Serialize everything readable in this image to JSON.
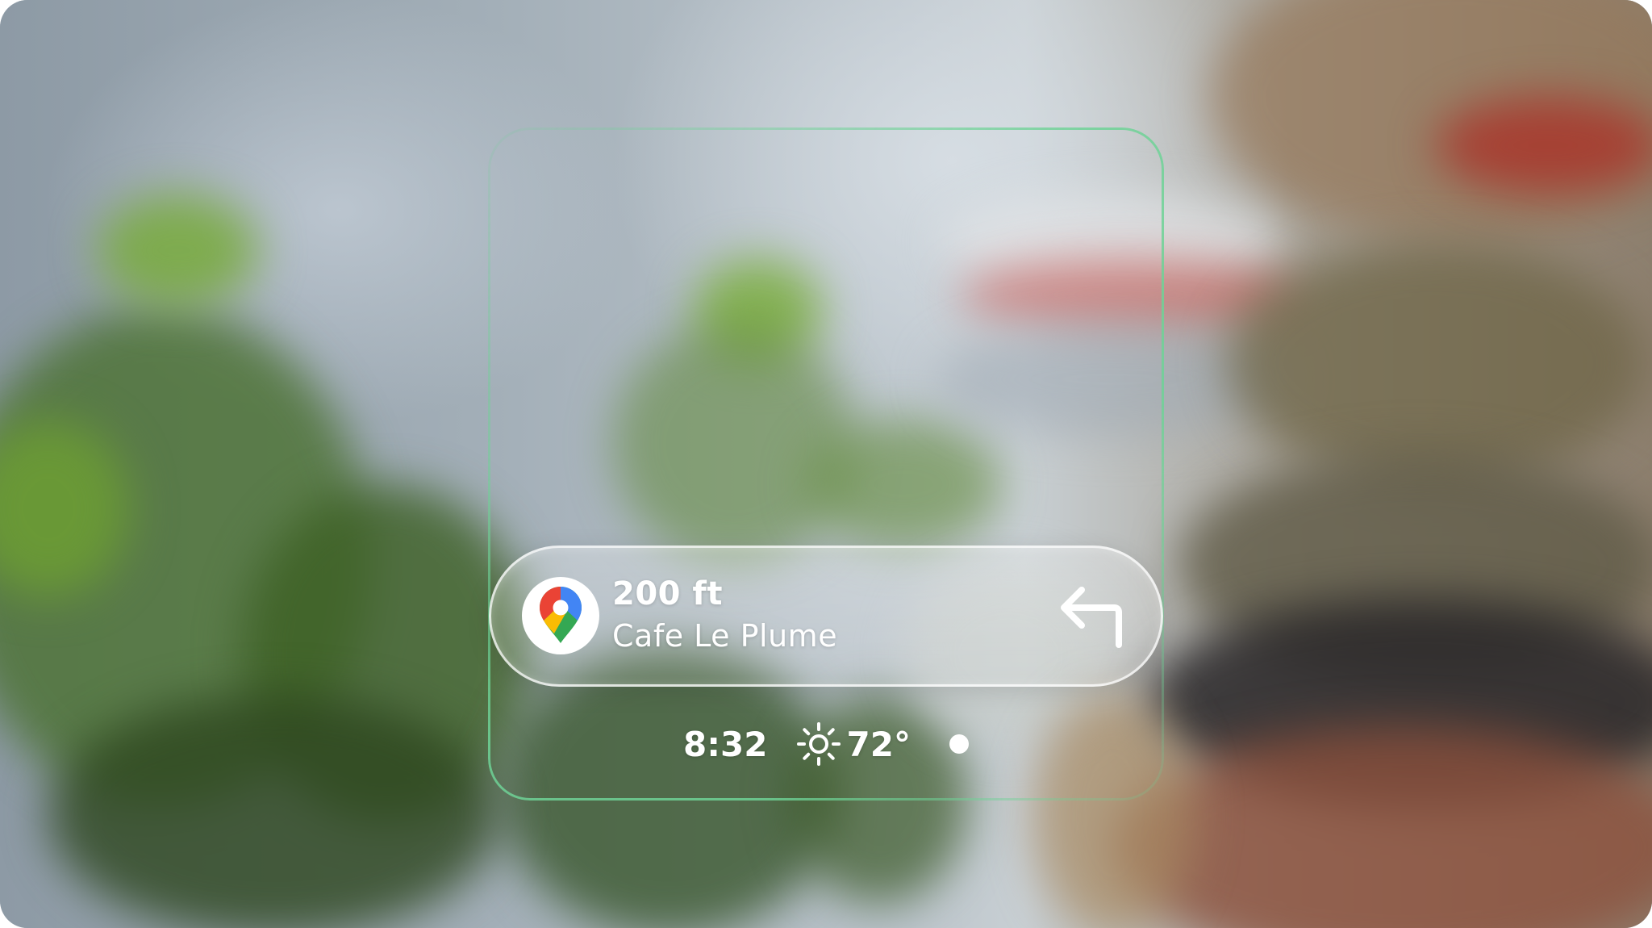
{
  "navigation": {
    "distance": "200 ft",
    "destination": "Cafe Le Plume",
    "app_icon": "google-maps-pin-icon",
    "turn_icon": "turn-left-arrow-icon"
  },
  "status": {
    "time": "8:32",
    "weather_icon": "sun-icon",
    "temperature": "72°",
    "indicator_icon": "dot-indicator"
  },
  "colors": {
    "frame_accent": "#6ed296",
    "text": "#ffffff",
    "pill_border": "#ffffff"
  }
}
